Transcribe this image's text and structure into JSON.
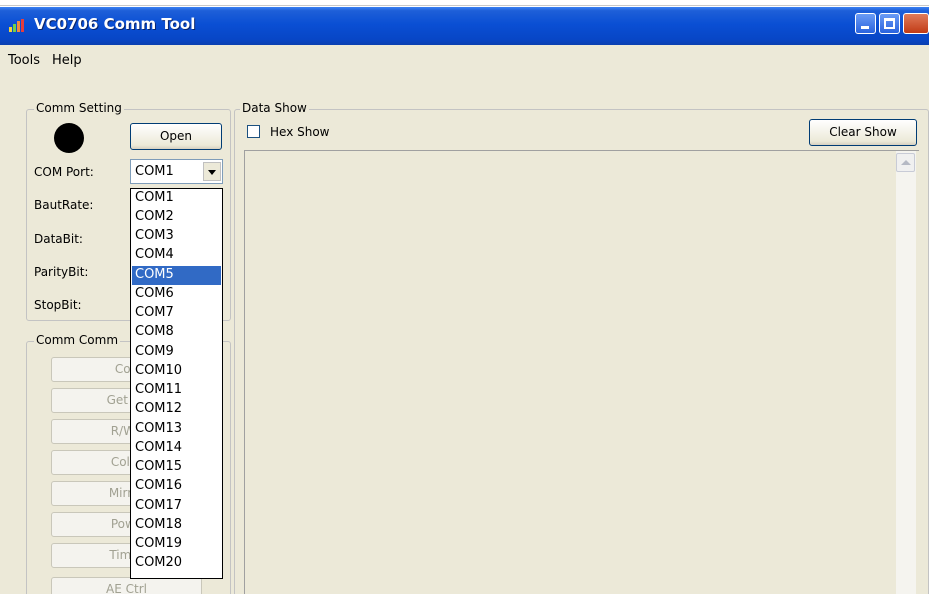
{
  "window": {
    "title": "VC0706 Comm Tool"
  },
  "menu": {
    "items": [
      "Tools",
      "Help"
    ]
  },
  "comm_setting": {
    "title": "Comm Setting",
    "open_label": "Open",
    "fields": [
      {
        "label": "COM Port:"
      },
      {
        "label": "BautRate:"
      },
      {
        "label": "DataBit:"
      },
      {
        "label": "ParityBit:"
      },
      {
        "label": "StopBit:"
      }
    ],
    "com_port_value": "COM1",
    "com_port_options": [
      "COM1",
      "COM2",
      "COM3",
      "COM4",
      "COM5",
      "COM6",
      "COM7",
      "COM8",
      "COM9",
      "COM10",
      "COM11",
      "COM12",
      "COM13",
      "COM14",
      "COM15",
      "COM16",
      "COM17",
      "COM18",
      "COM19",
      "COM20"
    ],
    "highlighted_option": "COM5",
    "status_led_color": "#000000"
  },
  "comm_command": {
    "title": "Comm Comm",
    "buttons": [
      "Con",
      "Get Ve",
      "R/W I",
      "Color",
      "Mirror",
      "Powe",
      "Timer",
      "AE Ctrl"
    ]
  },
  "data_show": {
    "title": "Data Show",
    "hex_show_label": "Hex Show",
    "hex_show_checked": false,
    "clear_label": "Clear Show"
  },
  "colors": {
    "titlebar": "#0a4fd4",
    "selection": "#316ac5",
    "face": "#ece9d8"
  }
}
